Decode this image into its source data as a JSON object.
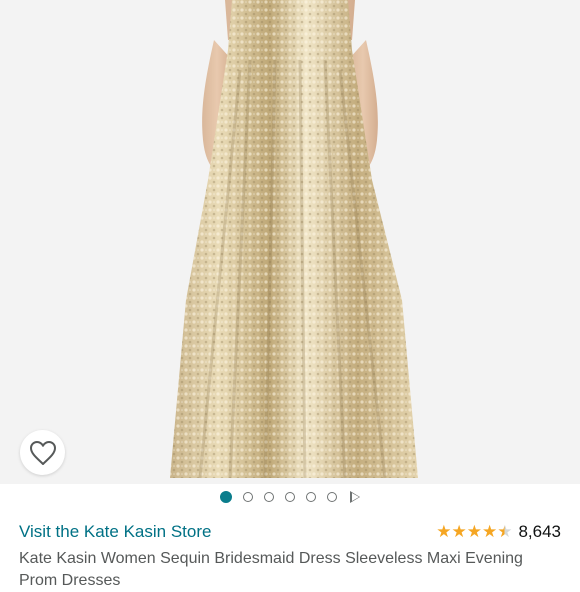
{
  "product": {
    "image_alt": "gold-sequin-maxi-dress-photo",
    "carousel": {
      "count": 6,
      "active_index": 0,
      "has_video": true
    },
    "store_link": "Visit the Kate Kasin Store",
    "rating": {
      "stars": 4.5,
      "count": "8,643"
    },
    "title": "Kate Kasin Women Sequin Bridesmaid Dress Sleeveless Maxi Evening Prom Dresses"
  },
  "colors": {
    "link": "#007185",
    "star": "#f5a623",
    "carousel_active": "#0b7d8c",
    "title": "#565959"
  },
  "icons": {
    "wishlist": "heart-outline-icon",
    "carousel_video": "play-icon"
  }
}
